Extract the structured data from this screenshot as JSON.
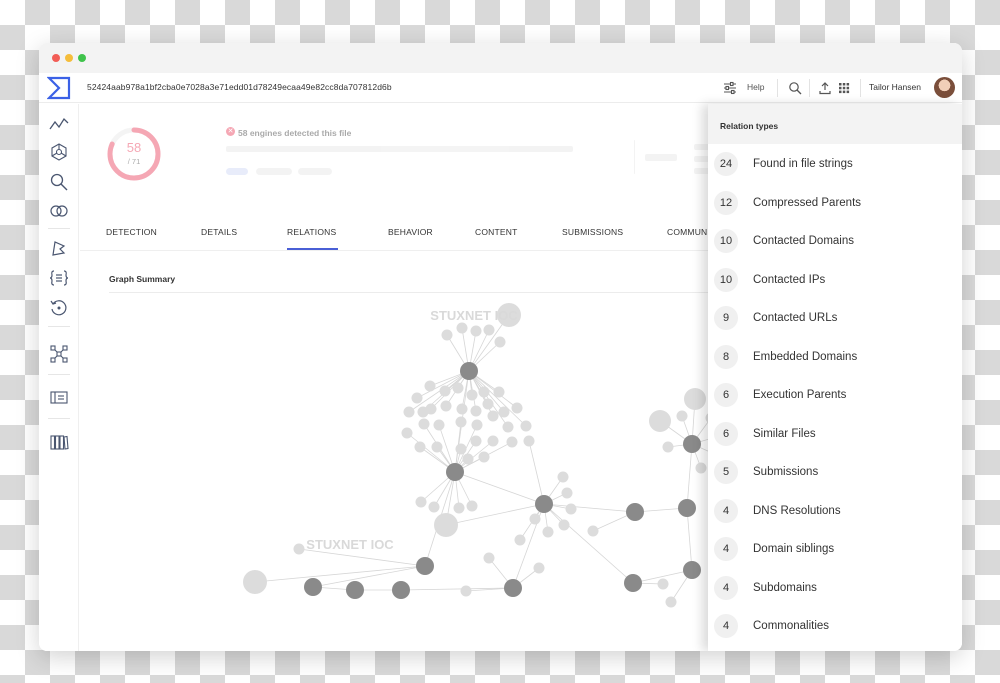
{
  "window": {
    "hash": "52424aab978a1bf2cba0e7028a3e71edd01d78249ecaa49e82cc8da707812d6b",
    "help_label": "Help",
    "user_name": "Tailor Hansen"
  },
  "summary": {
    "score": "58",
    "total": "/ 71",
    "detected_fraction": 0.817,
    "detection_text": "58 engines detected this file",
    "accent_color": "#e8304f"
  },
  "tabs": [
    "DETECTION",
    "DETAILS",
    "RELATIONS",
    "BEHAVIOR",
    "CONTENT",
    "SUBMISSIONS",
    "COMMUN"
  ],
  "active_tab": "RELATIONS",
  "graph": {
    "title": "Graph Summary",
    "label_top": "STUXNET IOC",
    "label_left": "STUXNET IOC"
  },
  "panel": {
    "title": "Relation types",
    "items": [
      {
        "count": "24",
        "label": "Found in file strings"
      },
      {
        "count": "12",
        "label": "Compressed Parents"
      },
      {
        "count": "10",
        "label": "Contacted Domains"
      },
      {
        "count": "10",
        "label": "Contacted IPs"
      },
      {
        "count": "9",
        "label": "Contacted URLs"
      },
      {
        "count": "8",
        "label": "Embedded Domains"
      },
      {
        "count": "6",
        "label": "Execution Parents"
      },
      {
        "count": "6",
        "label": "Similar Files"
      },
      {
        "count": "5",
        "label": "Submissions"
      },
      {
        "count": "4",
        "label": "DNS Resolutions"
      },
      {
        "count": "4",
        "label": "Domain siblings"
      },
      {
        "count": "4",
        "label": "Subdomains"
      },
      {
        "count": "4",
        "label": "Commonalities"
      }
    ]
  },
  "icons": {
    "topbar": [
      "filter-icon",
      "search-icon",
      "upload-icon",
      "grid-icon"
    ],
    "sidebar": [
      "graph-trend-icon",
      "network-hub-icon",
      "search-icon",
      "intersect-icon",
      "hunting-icon",
      "code-braces-icon",
      "retrohunt-icon",
      "graph-nodes-icon",
      "monitor-icon",
      "library-icon"
    ]
  }
}
